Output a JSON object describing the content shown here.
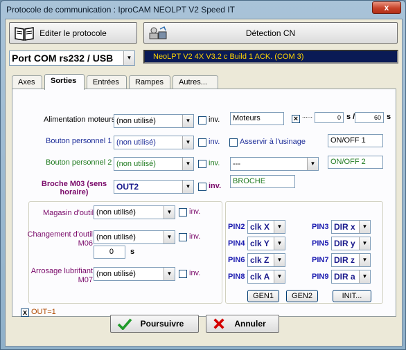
{
  "window": {
    "title": "Protocole de communication : IproCAM NEOLPT V2 Speed IT",
    "close_glyph": "x"
  },
  "toolbar": {
    "edit_label": "Editer le protocole",
    "detect_label": "Détection CN"
  },
  "port": {
    "selected": "Port COM rs232 / USB",
    "status": "NeoLPT V2 4X V3.2 c Build 1 ACK. (COM 3)"
  },
  "tabs": [
    "Axes",
    "Sorties",
    "Entrées",
    "Rampes",
    "Autres..."
  ],
  "rows": {
    "alim": {
      "label": "Alimentation moteurs",
      "value": "(non utilisé)",
      "inv": "inv.",
      "name": "Moteurs",
      "v1": "0",
      "unit1": "s /",
      "v2": "60",
      "unit2": "s",
      "dots": "......",
      "color": "#000000"
    },
    "bp1": {
      "label": "Bouton personnel 1",
      "value": "(non utilisé)",
      "inv": "inv.",
      "asservir": "Asservir à l'usinage",
      "name": "ON/OFF 1",
      "color": "#1f2f9a"
    },
    "bp2": {
      "label": "Bouton personnel 2",
      "value": "(non utilisé)",
      "inv": "inv.",
      "combo": "---",
      "name": "ON/OFF 2",
      "color": "#1f7a1f"
    },
    "m03": {
      "label": "Broche M03 (sens horaire)",
      "value": "OUT2",
      "inv": "inv.",
      "name": "BROCHE",
      "color": "#7a0a6a"
    }
  },
  "lower": {
    "magasin": {
      "label": "Magasin d'outil",
      "value": "(non utilisé)",
      "inv": "inv."
    },
    "changement": {
      "label": "Changement d'outil M06",
      "value": "(non utilisé)",
      "inv": "inv.",
      "delay": "0",
      "unit": "s"
    },
    "arrosage": {
      "label": "Arrosage lubrifiant M07",
      "value": "(non utilisé)",
      "inv": "inv."
    },
    "label_color": "#7a0a6a"
  },
  "pins": [
    {
      "pin": "PIN2",
      "val": "clk X",
      "pin2": "PIN3",
      "val2": "DIR x"
    },
    {
      "pin": "PIN4",
      "val": "clk Y",
      "pin2": "PIN5",
      "val2": "DIR y"
    },
    {
      "pin": "PIN6",
      "val": "clk Z",
      "pin2": "PIN7",
      "val2": "DIR z"
    },
    {
      "pin": "PIN8",
      "val": "clk A",
      "pin2": "PIN9",
      "val2": "DIR a"
    }
  ],
  "gen": {
    "gen1": "GEN1",
    "gen2": "GEN2",
    "init": "INIT..."
  },
  "out1": {
    "label": "OUT=1",
    "checked": "x"
  },
  "footer": {
    "ok": "Poursuivre",
    "cancel": "Annuler"
  },
  "colors": {
    "status_bg": "#0a1a55",
    "status_fg": "#ffd700",
    "accent_green": "#1f7a1f",
    "accent_red": "#c80000"
  }
}
